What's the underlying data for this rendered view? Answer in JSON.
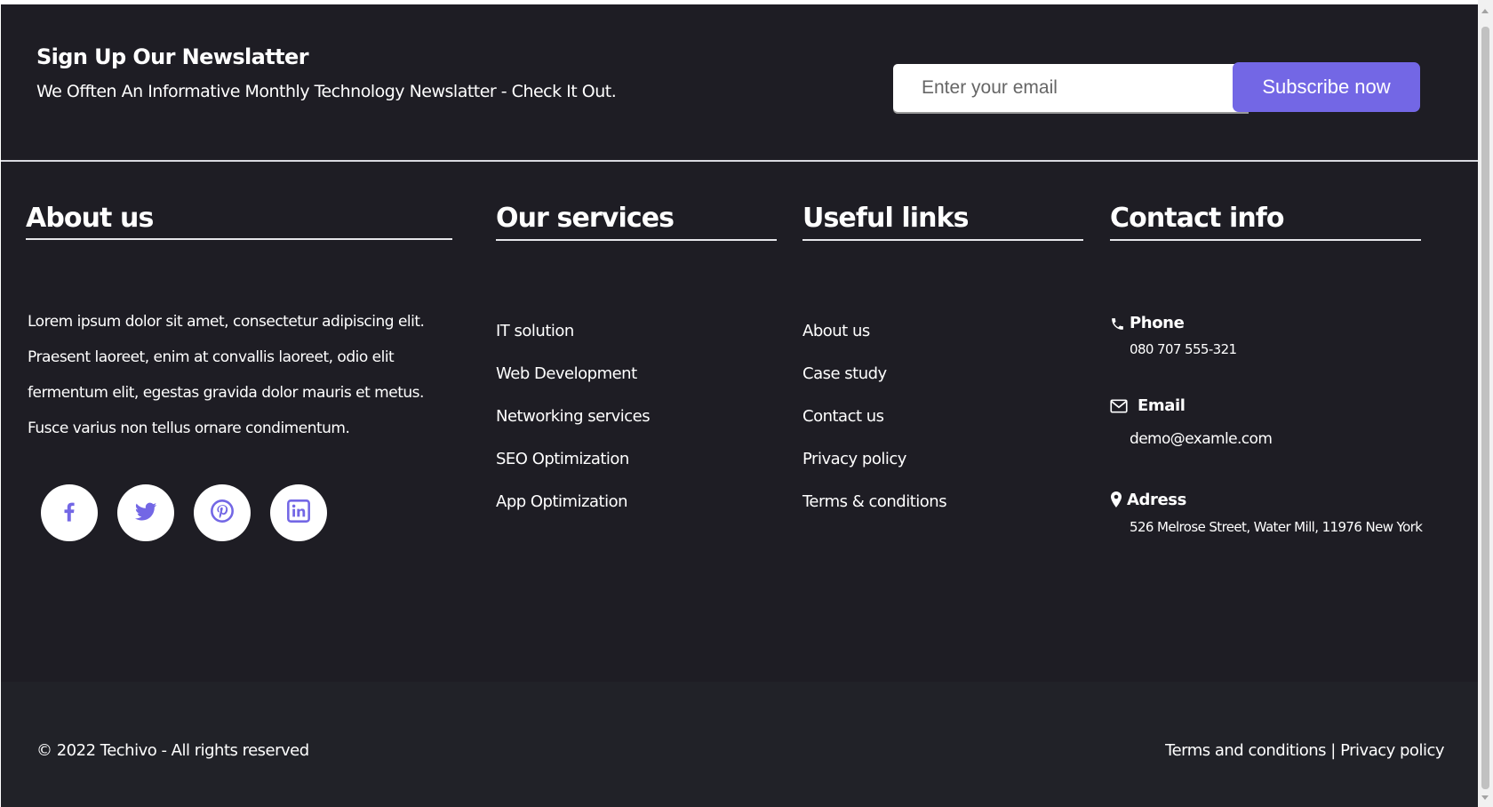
{
  "newsletter": {
    "title": "Sign Up Our Newslatter",
    "subtitle": "We Offten An Informative Monthly Technology Newslatter - Check It Out.",
    "email_placeholder": "Enter your email",
    "subscribe_label": "Subscribe now"
  },
  "about": {
    "title": "About us",
    "text": "Lorem ipsum dolor sit amet, consectetur adipiscing elit. Praesent laoreet, enim at convallis laoreet, odio elit fermentum elit, egestas gravida dolor mauris et metus. Fusce varius non tellus ornare condimentum.",
    "socials": [
      {
        "name": "facebook-icon"
      },
      {
        "name": "twitter-icon"
      },
      {
        "name": "pinterest-icon"
      },
      {
        "name": "linkedin-icon"
      }
    ]
  },
  "services": {
    "title": "Our services",
    "items": [
      "IT solution",
      "Web Development",
      "Networking services",
      "SEO Optimization",
      "App Optimization"
    ]
  },
  "useful_links": {
    "title": "Useful links",
    "items": [
      "About us",
      "Case study",
      "Contact us",
      "Privacy policy",
      "Terms & conditions"
    ]
  },
  "contact": {
    "title": "Contact info",
    "phone_label": "Phone",
    "phone_value": "080 707 555-321",
    "email_label": "Email",
    "email_value": "demo@examle.com",
    "address_label": "Adress",
    "address_value": "526 Melrose Street, Water Mill, 11976 New York"
  },
  "footer": {
    "copyright": "© 2022 Techivo - All rights reserved",
    "terms_label": "Terms and conditions",
    "separator": "|",
    "privacy_label": "Privacy policy"
  },
  "colors": {
    "background": "#1e1d24",
    "bottom_bar": "#212228",
    "accent": "#7367e5",
    "text": "#ffffff"
  }
}
